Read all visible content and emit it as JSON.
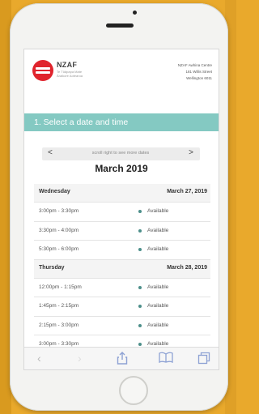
{
  "header": {
    "brand": "NZAF",
    "brand_sub": "Te Tūāpapa Mate Āraikore Aotearoa",
    "address_line1": "NZAF Awhina Centre",
    "address_line2": "181 Willis Street",
    "address_line3": "Wellington 6011"
  },
  "step": {
    "title": "1. Select a date and time"
  },
  "date_nav": {
    "prev": "<",
    "hint": "scroll right to see more dates",
    "next": ">"
  },
  "month": "March 2019",
  "schedule": {
    "days": [
      {
        "name": "Wednesday",
        "date": "March 27, 2019",
        "slots": [
          {
            "time": "3:00pm - 3:30pm",
            "status": "Available"
          },
          {
            "time": "3:30pm - 4:00pm",
            "status": "Available"
          },
          {
            "time": "5:30pm - 6:00pm",
            "status": "Available"
          }
        ]
      },
      {
        "name": "Thursday",
        "date": "March 28, 2019",
        "slots": [
          {
            "time": "12:00pm - 1:15pm",
            "status": "Available"
          },
          {
            "time": "1:45pm - 2:15pm",
            "status": "Available"
          },
          {
            "time": "2:15pm - 3:00pm",
            "status": "Available"
          },
          {
            "time": "3:00pm - 3:30pm",
            "status": "Available"
          }
        ]
      }
    ]
  },
  "browser_bar": {
    "back_icon": "back-arrow-icon",
    "forward_icon": "forward-arrow-icon",
    "share_icon": "share-icon",
    "bookmarks_icon": "book-icon",
    "tabs_icon": "tabs-icon"
  },
  "colors": {
    "background": "#e9a92c",
    "step_bar": "#84c9c2",
    "brand_red": "#e0242d",
    "status_dot": "#4c8f8a"
  }
}
